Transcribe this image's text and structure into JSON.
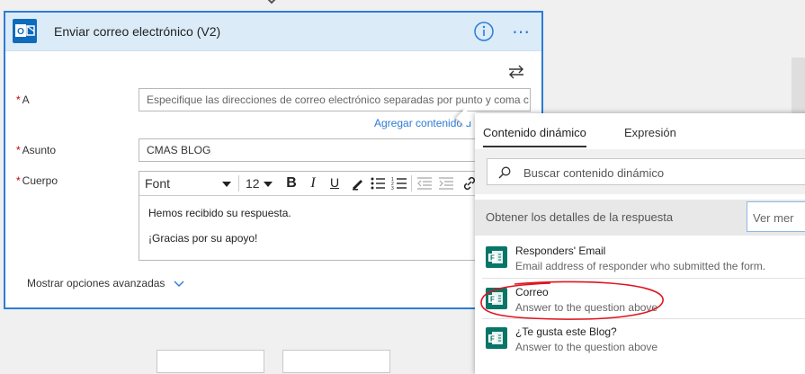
{
  "card": {
    "title": "Enviar correo electrónico (V2)",
    "to_label": "A",
    "to_placeholder": "Especifique las direcciones de correo electrónico separadas por punto y coma c",
    "add_dynamic": "Agregar contenido d",
    "subject_label": "Asunto",
    "subject_value": "CMAS BLOG",
    "body_label": "Cuerpo",
    "font_value": "Font",
    "size_value": "12",
    "bold_label": "B",
    "italic_label": "I",
    "underline_label": "U",
    "body_line1": "Hemos recibido su respuesta.",
    "body_line2": "¡Gracias por su apoyo!",
    "show_advanced": "Mostrar opciones avanzadas",
    "required_mark": "*"
  },
  "panel": {
    "tab_dynamic": "Contenido dinámico",
    "tab_expression": "Expresión",
    "search_placeholder": "Buscar contenido dinámico",
    "section_title": "Obtener los detalles de la respuesta",
    "see_more": "Ver mer",
    "items": [
      {
        "name": "Responders' Email",
        "desc": "Email address of responder who submitted the form."
      },
      {
        "name": "Correo",
        "desc": "Answer to the question above"
      },
      {
        "name": "¿Te gusta este Blog?",
        "desc": "Answer to the question above"
      }
    ]
  },
  "colors": {
    "accent": "#2c7cd6",
    "header_bg": "#dcebf8",
    "forms_green": "#077568",
    "annotation_red": "#e0141e"
  },
  "icons": [
    "outlook-icon",
    "info-icon",
    "more-icon",
    "swap-icon",
    "search-icon",
    "forms-icon",
    "pen-icon",
    "bullet-list-icon",
    "numbered-list-icon",
    "indent-icon",
    "outdent-icon",
    "link-icon",
    "chevron-down-icon"
  ]
}
